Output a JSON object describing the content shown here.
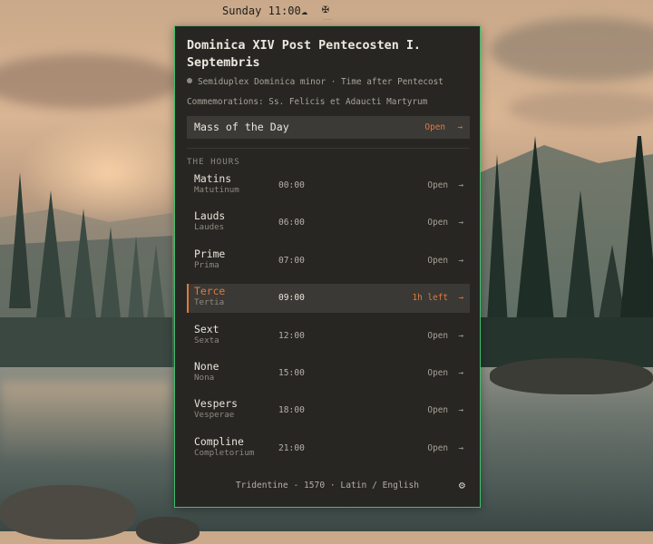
{
  "topbar": {
    "clock": "Sunday 11:00",
    "weather_icon": "cloud-icon",
    "app_icon": "cross-icon"
  },
  "panel": {
    "title": "Dominica XIV Post Pentecosten I. Septembris",
    "rank": "Semiduplex Dominica minor · Time after Pentecost",
    "commemorations": "Commemorations: Ss. Felicis et Adaucti Martyrum",
    "mass": {
      "label": "Mass of the Day",
      "action": "Open",
      "arrow": "→"
    },
    "section_title": "THE HOURS",
    "hours": [
      {
        "name": "Matins",
        "latin": "Matutinum",
        "time": "00:00",
        "status": "Open",
        "arrow": "→"
      },
      {
        "name": "Lauds",
        "latin": "Laudes",
        "time": "06:00",
        "status": "Open",
        "arrow": "→"
      },
      {
        "name": "Prime",
        "latin": "Prima",
        "time": "07:00",
        "status": "Open",
        "arrow": "→"
      },
      {
        "name": "Terce",
        "latin": "Tertia",
        "time": "09:00",
        "status": "1h left",
        "arrow": "→",
        "active": true
      },
      {
        "name": "Sext",
        "latin": "Sexta",
        "time": "12:00",
        "status": "Open",
        "arrow": "→"
      },
      {
        "name": "None",
        "latin": "Nona",
        "time": "15:00",
        "status": "Open",
        "arrow": "→"
      },
      {
        "name": "Vespers",
        "latin": "Vesperae",
        "time": "18:00",
        "status": "Open",
        "arrow": "→"
      },
      {
        "name": "Compline",
        "latin": "Completorium",
        "time": "21:00",
        "status": "Open",
        "arrow": "→"
      }
    ],
    "footer": "Tridentine - 1570 · Latin / English",
    "settings_icon": "gear-icon"
  },
  "colors": {
    "accent": "#e07a3b",
    "border": "#3ebf6a",
    "panel_bg": "#272623"
  }
}
